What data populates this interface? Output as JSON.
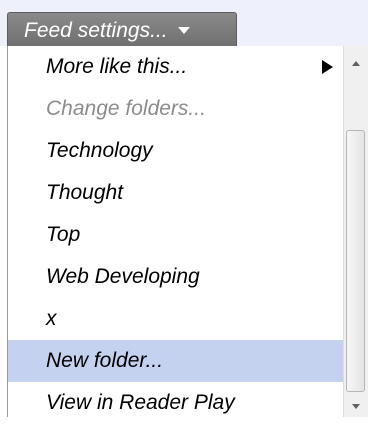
{
  "feed_settings_button": {
    "label": "Feed settings..."
  },
  "menu": {
    "items": [
      {
        "label": "More like this...",
        "has_submenu": true
      },
      {
        "label": "Change folders...",
        "disabled": true
      },
      {
        "label": "Technology"
      },
      {
        "label": "Thought"
      },
      {
        "label": "Top"
      },
      {
        "label": "Web Developing"
      },
      {
        "label": "x"
      },
      {
        "label": "New folder...",
        "highlighted": true
      },
      {
        "label": "View in Reader Play"
      }
    ]
  },
  "colors": {
    "highlight": "#c4d2ef",
    "button_bg": "#7b7b7b",
    "disabled_text": "#8c8c8c",
    "topbar_bg": "#eef1fb"
  },
  "icons": {
    "caret": "chevron-down-icon",
    "submenu": "submenu-arrow-icon",
    "scroll_up": "scroll-up-icon",
    "scroll_down": "scroll-down-icon"
  }
}
